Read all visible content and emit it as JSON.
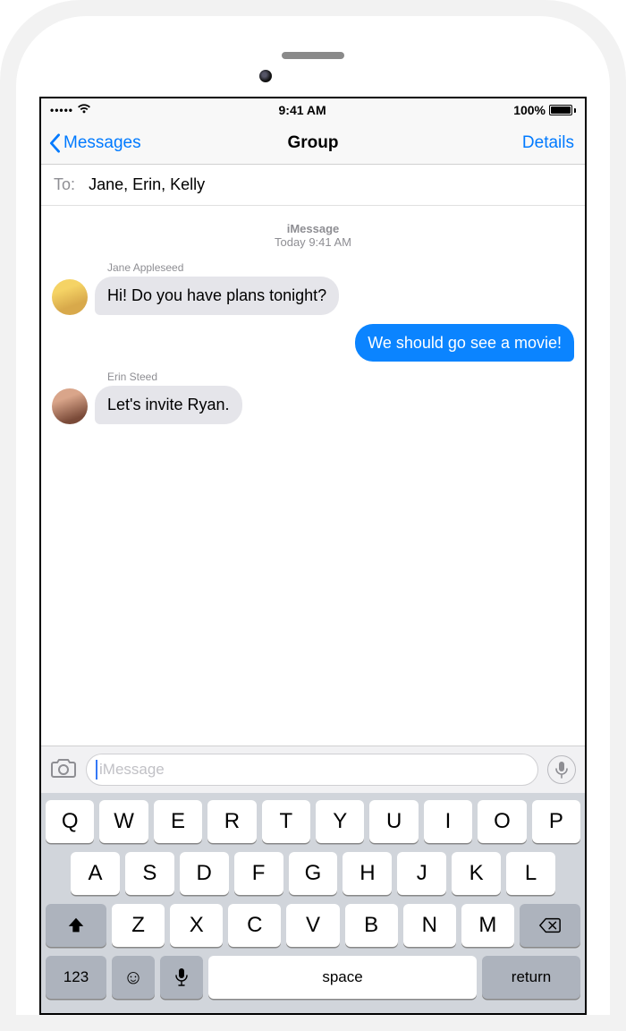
{
  "status": {
    "signal": "•••••",
    "time": "9:41 AM",
    "battery_pct": "100%"
  },
  "nav": {
    "back_label": "Messages",
    "title": "Group",
    "details": "Details"
  },
  "to": {
    "label": "To:",
    "names": "Jane, Erin, Kelly"
  },
  "thread": {
    "service": "iMessage",
    "timestamp_prefix": "Today",
    "timestamp_time": "9:41 AM"
  },
  "messages_list": [
    {
      "sender": "Jane Appleseed",
      "text": "Hi! Do you have plans tonight?",
      "direction": "in",
      "avatar": "jane"
    },
    {
      "sender": "",
      "text": "We should go see a movie!",
      "direction": "out",
      "avatar": ""
    },
    {
      "sender": "Erin Steed",
      "text": "Let's invite Ryan.",
      "direction": "in",
      "avatar": "erin"
    }
  ],
  "compose": {
    "placeholder": "iMessage"
  },
  "keyboard": {
    "row1": [
      "Q",
      "W",
      "E",
      "R",
      "T",
      "Y",
      "U",
      "I",
      "O",
      "P"
    ],
    "row2": [
      "A",
      "S",
      "D",
      "F",
      "G",
      "H",
      "J",
      "K",
      "L"
    ],
    "row3": [
      "Z",
      "X",
      "C",
      "V",
      "B",
      "N",
      "M"
    ],
    "k123": "123",
    "space": "space",
    "return": "return"
  }
}
